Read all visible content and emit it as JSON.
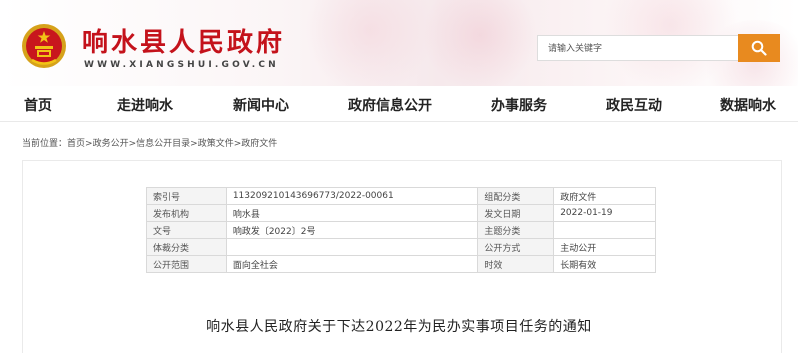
{
  "header": {
    "site_title": "响水县人民政府",
    "site_domain": "WWW.XIANGSHUI.GOV.CN",
    "search_placeholder": "请输入关键字",
    "emblem_icon": "national-emblem-icon",
    "search_icon": "search-icon",
    "accent_color": "#c4121b",
    "search_button_color": "#e88a1f"
  },
  "nav": {
    "items": [
      {
        "label": "首页"
      },
      {
        "label": "走进响水"
      },
      {
        "label": "新闻中心"
      },
      {
        "label": "政府信息公开"
      },
      {
        "label": "办事服务"
      },
      {
        "label": "政民互动"
      },
      {
        "label": "数据响水"
      }
    ]
  },
  "breadcrumb": {
    "prefix": "当前位置：",
    "items": [
      "首页",
      "政务公开",
      "信息公开目录",
      "政策文件",
      "政府文件"
    ],
    "separator": ">"
  },
  "meta": {
    "rows": [
      {
        "l1": "索引号",
        "v1": "113209210143696773/2022-00061",
        "l2": "组配分类",
        "v2": "政府文件"
      },
      {
        "l1": "发布机构",
        "v1": "响水县",
        "l2": "发文日期",
        "v2": "2022-01-19"
      },
      {
        "l1": "文号",
        "v1": "响政发〔2022〕2号",
        "l2": "主题分类",
        "v2": ""
      },
      {
        "l1": "体裁分类",
        "v1": "",
        "l2": "公开方式",
        "v2": "主动公开"
      },
      {
        "l1": "公开范围",
        "v1": "面向全社会",
        "l2": "时效",
        "v2": "长期有效"
      }
    ]
  },
  "document": {
    "title": "响水县人民政府关于下达2022年为民办实事项目任务的通知"
  }
}
